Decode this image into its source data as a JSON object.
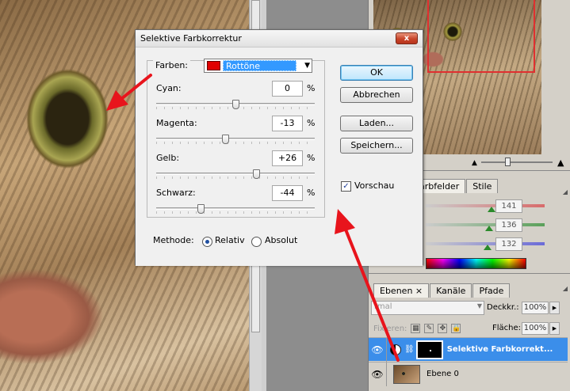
{
  "dialog": {
    "title": "Selektive Farbkorrektur",
    "close_label": "x",
    "farben_label": "Farben:",
    "farben_value": "Rottöne",
    "farben_swatch_color": "#e00000",
    "sliders": [
      {
        "label": "Cyan:",
        "value": "0",
        "unit": "%",
        "level": 0.0
      },
      {
        "label": "Magenta:",
        "value": "-13",
        "unit": "%",
        "level": -0.13
      },
      {
        "label": "Gelb:",
        "value": "+26",
        "unit": "%",
        "level": 0.26
      },
      {
        "label": "Schwarz:",
        "value": "-44",
        "unit": "%",
        "level": -0.44
      }
    ],
    "buttons": {
      "ok": "OK",
      "cancel": "Abbrechen",
      "load": "Laden...",
      "save": "Speichern..."
    },
    "preview_label": "Vorschau",
    "preview_checked": true,
    "method_label": "Methode:",
    "method_options": [
      "Relativ",
      "Absolut"
    ],
    "method_selected": "Relativ"
  },
  "color_panel": {
    "tabs": [
      "arbfelder",
      "Stile"
    ],
    "channels": [
      {
        "value": "141",
        "level": 0.553,
        "color": "#d86b6b"
      },
      {
        "value": "136",
        "level": 0.533,
        "color": "#5aa05a"
      },
      {
        "value": "132",
        "level": 0.518,
        "color": "#6b6bd8"
      }
    ]
  },
  "layers_panel": {
    "tabs": [
      "Ebenen",
      "Kanäle",
      "Pfade"
    ],
    "tab_close": "×",
    "blend_mode": "rmal",
    "opacity_label": "Deckkr.:",
    "opacity_value": "100%",
    "lock_label": "Fixieren:",
    "fill_label": "Fläche:",
    "fill_value": "100%",
    "layers": [
      {
        "name": "Selektive Farbkorrekt...",
        "selected": true
      },
      {
        "name": "Ebene 0",
        "selected": false
      }
    ]
  },
  "colors": {
    "accent": "#3b8eea",
    "arrow": "#e8141c"
  }
}
